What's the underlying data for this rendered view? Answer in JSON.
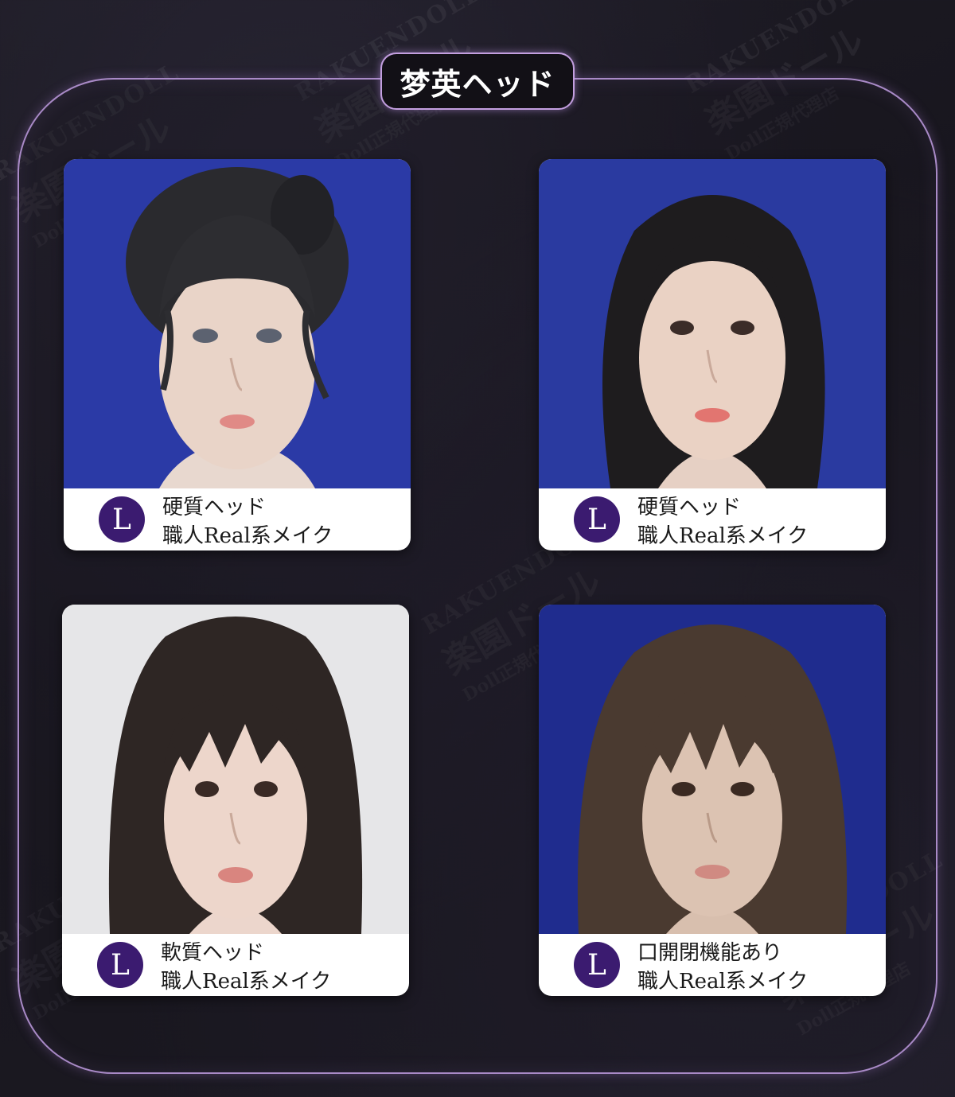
{
  "title": "梦英ヘッド",
  "watermark": {
    "brand": "RAKUENDOLL",
    "name": "楽園ドール",
    "sub": "Doll正規代理店"
  },
  "cards": [
    {
      "size": "L",
      "line1": "硬質ヘッド",
      "line2": "職人Real系メイク",
      "bg": "#2b3aa6"
    },
    {
      "size": "L",
      "line1": "硬質ヘッド",
      "line2": "職人Real系メイク",
      "bg": "#2a3aa0"
    },
    {
      "size": "L",
      "line1": "軟質ヘッド",
      "line2": "職人Real系メイク",
      "bg": "#e6e6e8"
    },
    {
      "size": "L",
      "line1": "口開閉機能あり",
      "line2": "職人Real系メイク",
      "bg": "#1f2c8e"
    }
  ],
  "colors": {
    "frame": "#a98ac7",
    "badge": "#3b1b70",
    "page_bg": "#1b1922"
  }
}
